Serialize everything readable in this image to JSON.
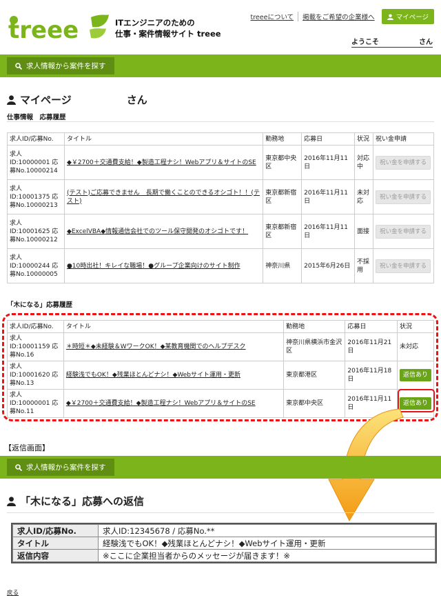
{
  "header": {
    "logo_text": "treee",
    "tagline_line1": "ITエンジニアのための",
    "tagline_line2": "仕事・案件情報サイト treee",
    "links": [
      "treeeについて",
      "掲載をご希望の企業様へ"
    ],
    "mypage_button": "マイページ",
    "welcome_prefix": "ようこそ",
    "welcome_suffix": "さん"
  },
  "search_button": "求人情報から案件を探す",
  "mypage": {
    "title": "マイページ",
    "title_suffix": "さん",
    "section1": "仕事情報　応募履歴",
    "table1": {
      "headers": [
        "求人ID/応募No.",
        "タイトル",
        "勤務地",
        "応募日",
        "状況",
        "祝い金申請"
      ],
      "rows": [
        {
          "id": "求人ID:10000001 応募No.10000214",
          "title": "◆￥2700＋交通費支給！◆製造工程ナシ！Webアプリ＆サイトのSE",
          "place": "東京都中央区",
          "date": "2016年11月11日",
          "status": "対応中",
          "action": "祝い金を申請する"
        },
        {
          "id": "求人ID:10001375 応募No.10000213",
          "title": "(テスト)ご応募できません　長期で働くことのできるオシゴト！！(テスト)",
          "place": "東京都新宿区",
          "date": "2016年11月11日",
          "status": "未対応",
          "action": "祝い金を申請する"
        },
        {
          "id": "求人ID:10001625 応募No.10000212",
          "title": "◆ExcelVBA◆情報通信会社でのツール保守開発のオシゴトです！",
          "place": "東京都新宿区",
          "date": "2016年11月11日",
          "status": "面接",
          "action": "祝い金を申請する"
        },
        {
          "id": "求人ID:10000244 応募No.10000005",
          "title": "●10時出社！キレイな職場！●グループ企業向けのサイト制作",
          "place": "神奈川県",
          "date": "2015年6月26日",
          "status": "不採用",
          "action": "祝い金を申請する"
        }
      ]
    },
    "section2": "「木になる」応募履歴",
    "table2": {
      "headers": [
        "求人ID/応募No.",
        "タイトル",
        "勤務地",
        "応募日",
        "状況"
      ],
      "rows": [
        {
          "id": "求人ID:10001159 応募No.16",
          "title": "＊時短＊◆未経験＆WワークOK！◆某教育機関でのヘルプデスク",
          "place": "神奈川県横浜市金沢区",
          "date": "2016年11月21日",
          "status": "未対応"
        },
        {
          "id": "求人ID:10001620 応募No.13",
          "title": "経験浅でもOK！◆残業ほとんどナシ！◆Webサイト運用・更新",
          "place": "東京都港区",
          "date": "2016年11月18日",
          "status": "返信あり"
        },
        {
          "id": "求人ID:10000001 応募No.11",
          "title": "◆￥2700＋交通費支給！◆製造工程ナシ！Webアプリ＆サイトのSE",
          "place": "東京都中央区",
          "date": "2016年11月11日",
          "status": "返信あり"
        }
      ]
    }
  },
  "reply_screen_label": "【返信画面】",
  "reply": {
    "title": "「木になる」応募への返信",
    "rows": [
      {
        "key": "求人ID/応募No.",
        "value": "求人ID:12345678 / 応募No.**"
      },
      {
        "key": "タイトル",
        "value": "経験浅でもOK！◆残業ほとんどナシ！◆Webサイト運用・更新"
      },
      {
        "key": "返信内容",
        "value": "※ここに企業担当者からのメッセージが届きます！※"
      }
    ]
  },
  "back_link": "戻る",
  "colors": {
    "brand_green": "#7bb41b",
    "highlight_red": "#e11111",
    "arrow_orange": "#f5a51e"
  }
}
